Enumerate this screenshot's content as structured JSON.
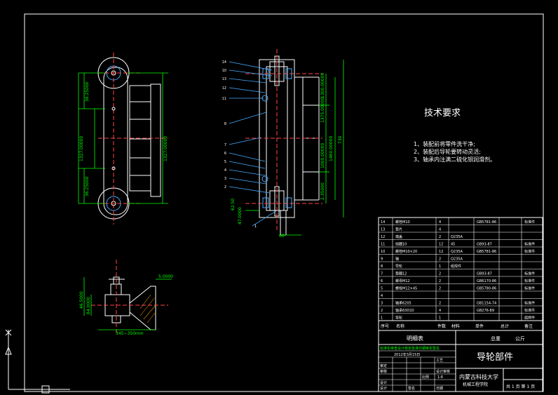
{
  "tech": {
    "title": "技术要求",
    "items": [
      "1、装配前将零件洗干净;",
      "2、装配后导轮要转动灵活;",
      "3、轴承内注满二硫化钼润滑剂。"
    ]
  },
  "front_dims": {
    "d1": "36.25000",
    "d2": "1327.00000",
    "d3": "1327.00000",
    "d4": "36.25000"
  },
  "side_dims": {
    "h_total": "1375.00000",
    "h_a": "1300.00000",
    "h_b": "1460.00000",
    "h_c": "1000.00000",
    "h_d": "2.35000",
    "h_e": "730",
    "w_a": "62.50",
    "w_b": "47.0000",
    "w_c": "60"
  },
  "detail_dims": {
    "top": "5.0000",
    "left_a": "46.5000",
    "left_b": "84.0000",
    "bottom": "345~350mm"
  },
  "balloons": [
    "14",
    "10",
    "13",
    "12",
    "11",
    "8",
    "7",
    "6",
    "5",
    "4",
    "3",
    "2",
    "1"
  ],
  "bom": {
    "rows": [
      {
        "no": "14",
        "name": "螺栓M10",
        "qty": "4",
        "mat": "",
        "std": "GB5781-86",
        "note": "标准件"
      },
      {
        "no": "13",
        "name": "垫片",
        "qty": "4",
        "mat": "",
        "std": "",
        "note": ""
      },
      {
        "no": "12",
        "name": "端盖",
        "qty": "2",
        "mat": "Q235A",
        "std": "",
        "note": ""
      },
      {
        "no": "11",
        "name": "挡圈10",
        "qty": "12",
        "mat": "45",
        "std": "GB93-87",
        "note": "标准件"
      },
      {
        "no": "10",
        "name": "螺栓M10×20",
        "qty": "12",
        "mat": "Q235A",
        "std": "GB5781-86",
        "note": "标准件"
      },
      {
        "no": "9",
        "name": "轴",
        "qty": "2",
        "mat": "Q235A",
        "std": "",
        "note": ""
      },
      {
        "no": "8",
        "name": "导轮",
        "qty": "1",
        "mat": "组焊件",
        "std": "",
        "note": ""
      },
      {
        "no": "7",
        "name": "垫圈12",
        "qty": "2",
        "mat": "",
        "std": "GB93-87",
        "note": "标准件"
      },
      {
        "no": "6",
        "name": "螺母M12",
        "qty": "2",
        "mat": "",
        "std": "GB6170-86",
        "note": "标准件"
      },
      {
        "no": "5",
        "name": "螺栓M12×45",
        "qty": "2",
        "mat": "",
        "std": "GB5780-86",
        "note": "标准件"
      },
      {
        "no": "4",
        "name": "",
        "qty": "",
        "mat": "",
        "std": "",
        "note": ""
      },
      {
        "no": "3",
        "name": "轴承6205",
        "qty": "2",
        "mat": "",
        "std": "GB1154-74",
        "note": "标准件"
      },
      {
        "no": "2",
        "name": "轴承6301D",
        "qty": "4",
        "mat": "",
        "std": "GB276-89",
        "note": "标准件"
      },
      {
        "no": "1",
        "name": "导轮",
        "qty": "1",
        "mat": "",
        "std": "",
        "note": "组焊件"
      }
    ],
    "header": {
      "no": "序号",
      "name": "名称",
      "qty": "件数",
      "mat": "材料",
      "unit": "单件",
      "total": "总计",
      "note": "备注"
    },
    "weight_label": "重量",
    "detail_label": "明细表",
    "total_weight": "总重",
    "unit_kg": "公斤"
  },
  "title_block": {
    "drawing_title": "导轮部件",
    "school": "内蒙古科技大学",
    "dept": "机械工程学院",
    "date": "2012年3月15日",
    "scale_label": "比例",
    "scale": "1:6",
    "sheet": "共 1 页 第 1 页",
    "rows_left": [
      "更改标记",
      "审定",
      "审核",
      "设计",
      "标准化",
      "批准"
    ],
    "rows_mid": [
      "工艺",
      "设计审核",
      "会签",
      "签名"
    ],
    "design": "设计",
    "sign": "签名",
    "check_date": "日期",
    "note_row": "标准化审查设计核定批准日期审定签名"
  }
}
